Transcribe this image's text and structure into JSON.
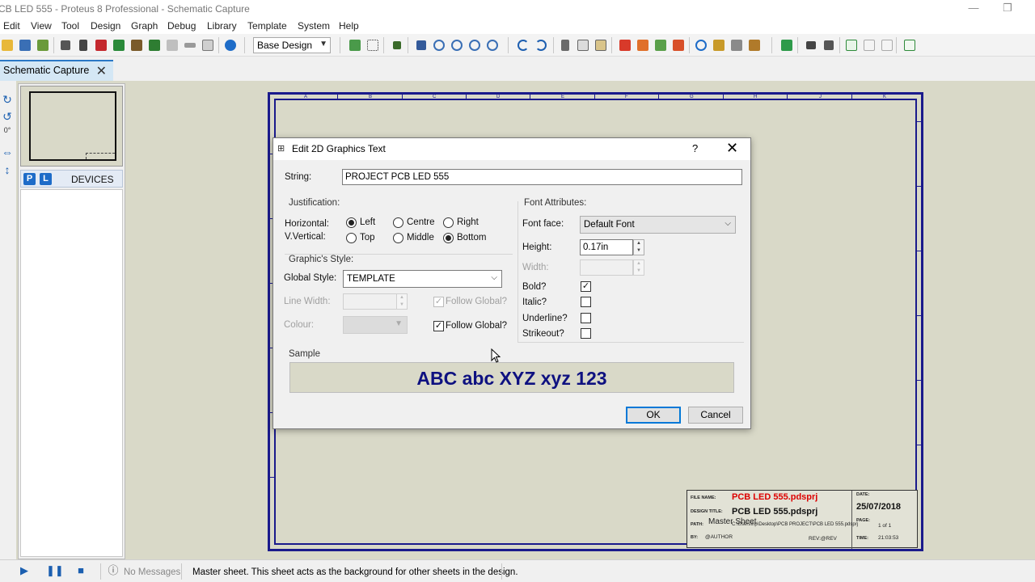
{
  "window": {
    "title": "CB LED 555 - Proteus 8 Professional - Schematic Capture",
    "minimize_glyph": "—",
    "maximize_glyph": "❐"
  },
  "menu": [
    "Edit",
    "View",
    "Tool",
    "Design",
    "Graph",
    "Debug",
    "Library",
    "Template",
    "System",
    "Help"
  ],
  "toolbar": {
    "design_combo": "Base Design"
  },
  "tab": {
    "label": "Schematic Capture",
    "close": "✕"
  },
  "left_strip": {
    "angle_text": "0°"
  },
  "left_panel": {
    "p_button": "P",
    "l_button": "L",
    "header": "DEVICES"
  },
  "sheet": {
    "columns": [
      "A",
      "B",
      "C",
      "D",
      "E",
      "F",
      "G",
      "H",
      "J",
      "K"
    ]
  },
  "title_block": {
    "file_name_label": "FILE NAME:",
    "file_name": "PCB LED 555.pdsprj",
    "design_title_label": "DESIGN TITLE:",
    "design_title": "PCB LED 555.pdsprj",
    "sheet_name": "Master Sheet",
    "path_label": "PATH:",
    "path": "C:\\Users\\hp\\Desktop\\PCB PROJECT\\PCB LED 555.pdsprj",
    "by_label": "BY:",
    "author": "@AUTHOR",
    "rev": "REV:@REV",
    "date_label": "DATE:",
    "date": "25/07/2018",
    "page_label": "PAGE:",
    "page": "1 of 1",
    "time_label": "TIME:",
    "time": "21:03:53"
  },
  "dialog": {
    "title": "Edit 2D Graphics Text",
    "help": "?",
    "close": "✕",
    "string_label": "String:",
    "string_value": "PROJECT PCB LED 555",
    "justification": {
      "group": "Justification:",
      "horizontal_label": "Horizontal:",
      "vertical_label": "V.Vertical:",
      "left": "Left",
      "centre": "Centre",
      "right": "Right",
      "top": "Top",
      "middle": "Middle",
      "bottom": "Bottom"
    },
    "graphics_style": {
      "group": "Graphic's Style:",
      "global_style_label": "Global Style:",
      "global_style_value": "TEMPLATE",
      "line_width_label": "Line Width:",
      "colour_label": "Colour:",
      "follow_global_1": "Follow Global?",
      "follow_global_2": "Follow Global?"
    },
    "font": {
      "group": "Font Attributes:",
      "face_label": "Font face:",
      "face_value": "Default Font",
      "height_label": "Height:",
      "height_value": "0.17in",
      "width_label": "Width:",
      "bold_label": "Bold?",
      "italic_label": "Italic?",
      "underline_label": "Underline?",
      "strikeout_label": "Strikeout?",
      "bold": true,
      "italic": false,
      "underline": false,
      "strikeout": false
    },
    "sample_label": "Sample",
    "sample_text": "ABC abc XYZ xyz 123",
    "ok": "OK",
    "cancel": "Cancel",
    "sample_color": "#0e1180"
  },
  "statusbar": {
    "messages": "No Messages",
    "hint": "Master sheet. This sheet acts as the background for other sheets in the design."
  }
}
